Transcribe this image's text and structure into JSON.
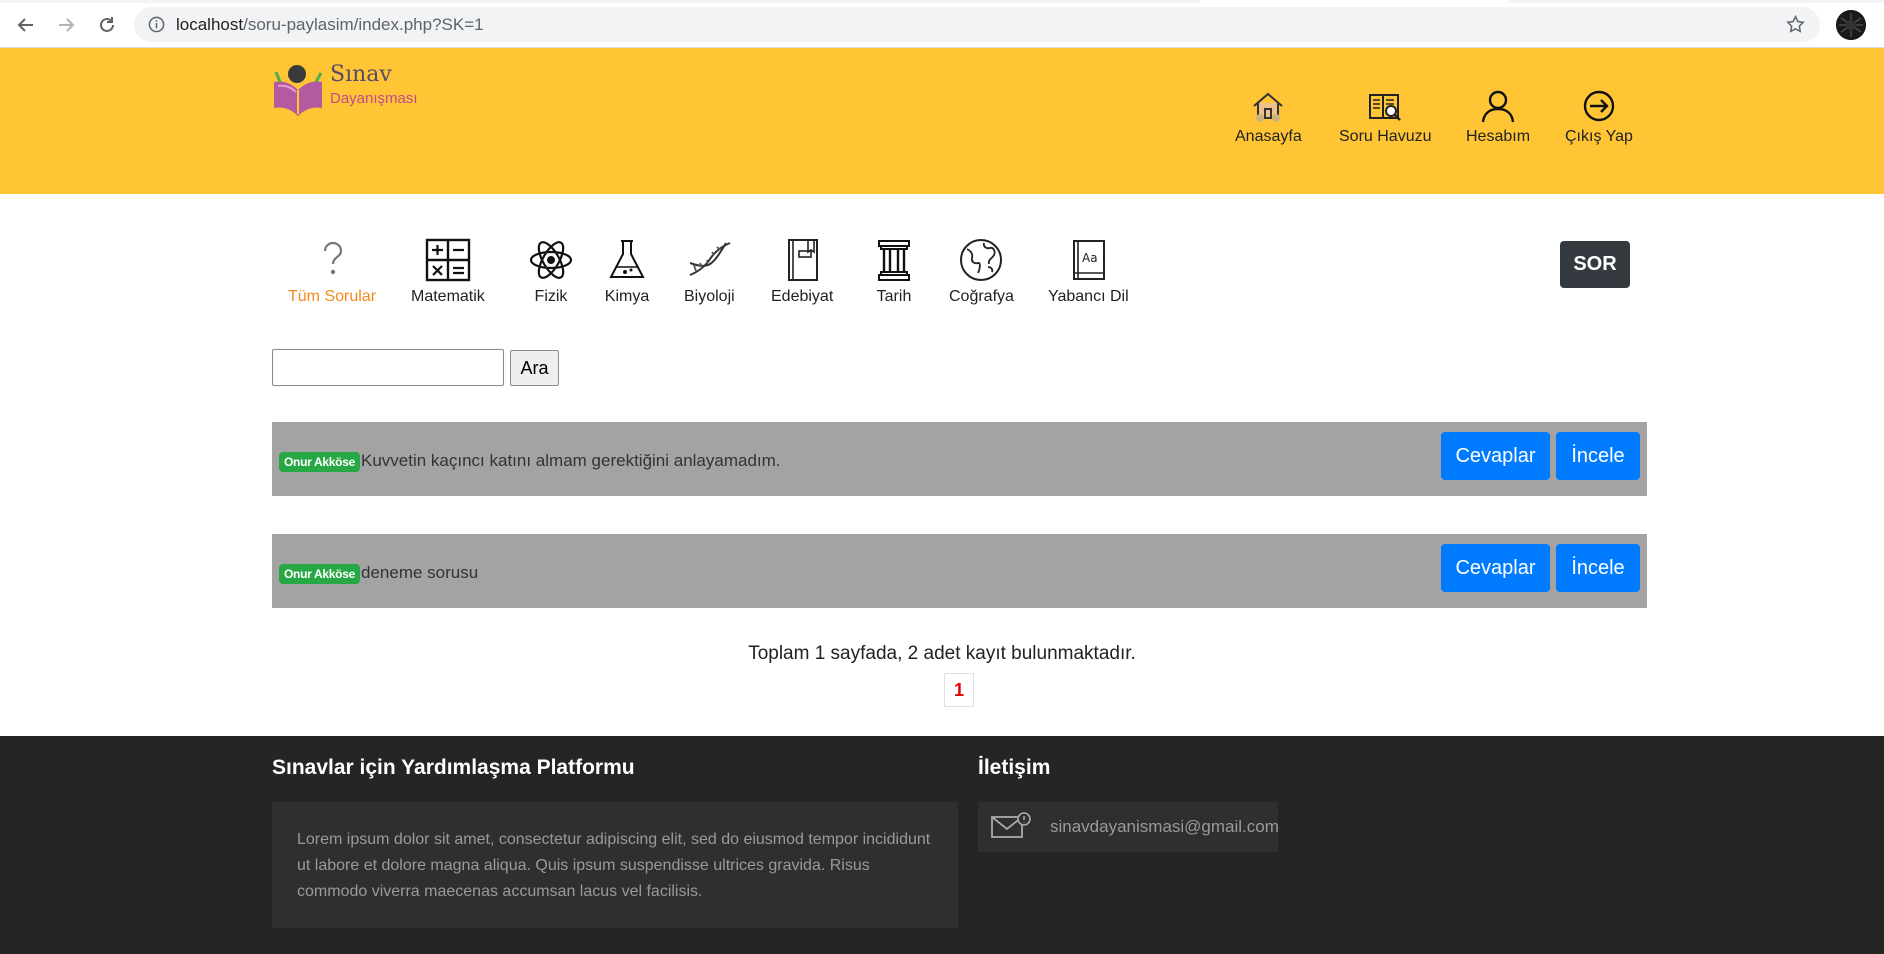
{
  "browser": {
    "url_host": "localhost",
    "url_path": "/soru-paylasim/index.php?SK=1"
  },
  "logo": {
    "line1": "Sınav",
    "line2": "Dayanışması"
  },
  "topnav": [
    {
      "label": "Anasayfa",
      "icon": "home-icon"
    },
    {
      "label": "Soru Havuzu",
      "icon": "book-search-icon"
    },
    {
      "label": "Hesabım",
      "icon": "user-icon"
    },
    {
      "label": "Çıkış Yap",
      "icon": "logout-icon"
    }
  ],
  "categories": [
    {
      "label": "Tüm Sorular",
      "icon": "question-icon",
      "active": true
    },
    {
      "label": "Matematik",
      "icon": "calculator-icon"
    },
    {
      "label": "Fizik",
      "icon": "atom-icon"
    },
    {
      "label": "Kimya",
      "icon": "flask-icon"
    },
    {
      "label": "Biyoloji",
      "icon": "dna-icon"
    },
    {
      "label": "Edebiyat",
      "icon": "book-icon"
    },
    {
      "label": "Tarih",
      "icon": "column-icon"
    },
    {
      "label": "Coğrafya",
      "icon": "globe-icon"
    },
    {
      "label": "Yabancı Dil",
      "icon": "dictionary-icon"
    }
  ],
  "sor_label": "SOR",
  "search": {
    "value": "",
    "button_label": "Ara"
  },
  "questions": [
    {
      "author": "Onur Akköse",
      "text": "Kuvvetin kaçıncı katını almam gerektiğini anlayamadım.",
      "answers_label": "Cevaplar",
      "view_label": "İncele"
    },
    {
      "author": "Onur Akköse",
      "text": "deneme sorusu",
      "answers_label": "Cevaplar",
      "view_label": "İncele"
    }
  ],
  "summary": "Toplam 1 sayfada, 2 adet kayıt bulunmaktadır.",
  "pagination": {
    "current": "1"
  },
  "footer": {
    "about_title": "Sınavlar için Yardımlaşma Platformu",
    "about_text": "Lorem ipsum dolor sit amet, consectetur adipiscing elit, sed do eiusmod tempor incididunt ut labore et dolore magna aliqua. Quis ipsum suspendisse ultrices gravida. Risus commodo viverra maecenas accumsan lacus vel facilisis.",
    "contact_title": "İletişim",
    "email": "sinavdayanismasi@gmail.com"
  },
  "colors": {
    "header_bg": "#ffc535",
    "active_category": "#f28b1c",
    "button_primary": "#007bff",
    "badge": "#28a745",
    "footer_bg": "#252525"
  }
}
